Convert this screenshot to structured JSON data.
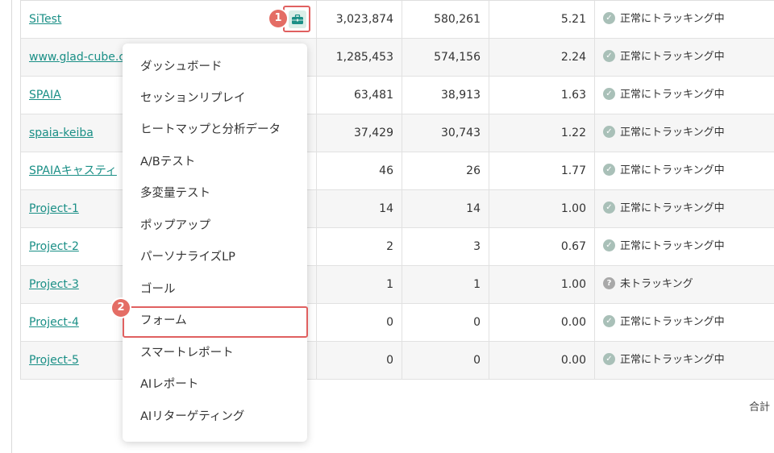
{
  "rows": [
    {
      "name": "SiTest",
      "v1": "3,023,874",
      "v2": "580,261",
      "v3": "5.21",
      "status": "正常にトラッキング中",
      "status_type": "ok"
    },
    {
      "name": "www.glad-cube.c",
      "v1": "1,285,453",
      "v2": "574,156",
      "v3": "2.24",
      "status": "正常にトラッキング中",
      "status_type": "ok"
    },
    {
      "name": "SPAIA",
      "v1": "63,481",
      "v2": "38,913",
      "v3": "1.63",
      "status": "正常にトラッキング中",
      "status_type": "ok"
    },
    {
      "name": "spaia-keiba",
      "v1": "37,429",
      "v2": "30,743",
      "v3": "1.22",
      "status": "正常にトラッキング中",
      "status_type": "ok"
    },
    {
      "name": "SPAIAキャスティ",
      "v1": "46",
      "v2": "26",
      "v3": "1.77",
      "status": "正常にトラッキング中",
      "status_type": "ok"
    },
    {
      "name": "Project-1",
      "v1": "14",
      "v2": "14",
      "v3": "1.00",
      "status": "正常にトラッキング中",
      "status_type": "ok"
    },
    {
      "name": "Project-2",
      "v1": "2",
      "v2": "3",
      "v3": "0.67",
      "status": "正常にトラッキング中",
      "status_type": "ok"
    },
    {
      "name": "Project-3",
      "v1": "1",
      "v2": "1",
      "v3": "1.00",
      "status": "未トラッキング",
      "status_type": "unknown"
    },
    {
      "name": "Project-4",
      "v1": "0",
      "v2": "0",
      "v3": "0.00",
      "status": "正常にトラッキング中",
      "status_type": "ok"
    },
    {
      "name": "Project-5",
      "v1": "0",
      "v2": "0",
      "v3": "0.00",
      "status": "正常にトラッキング中",
      "status_type": "ok"
    }
  ],
  "menu": {
    "items": [
      "ダッシュボード",
      "セッションリプレイ",
      "ヒートマップと分析データ",
      "A/Bテスト",
      "多変量テスト",
      "ポップアップ",
      "パーソナライズLP",
      "ゴール",
      "フォーム",
      "スマートレポート",
      "AIレポート",
      "AIリターゲティング"
    ]
  },
  "badges": {
    "step1": "1",
    "step2": "2"
  },
  "footer": {
    "total_label": "合計"
  },
  "icons": {
    "menu_button": "briefcase-icon",
    "ok_status": "check-circle-icon",
    "unknown_status": "question-circle-icon"
  },
  "colors": {
    "link": "#1a8f86",
    "highlight": "#e06060",
    "badge": "#e46d65"
  }
}
